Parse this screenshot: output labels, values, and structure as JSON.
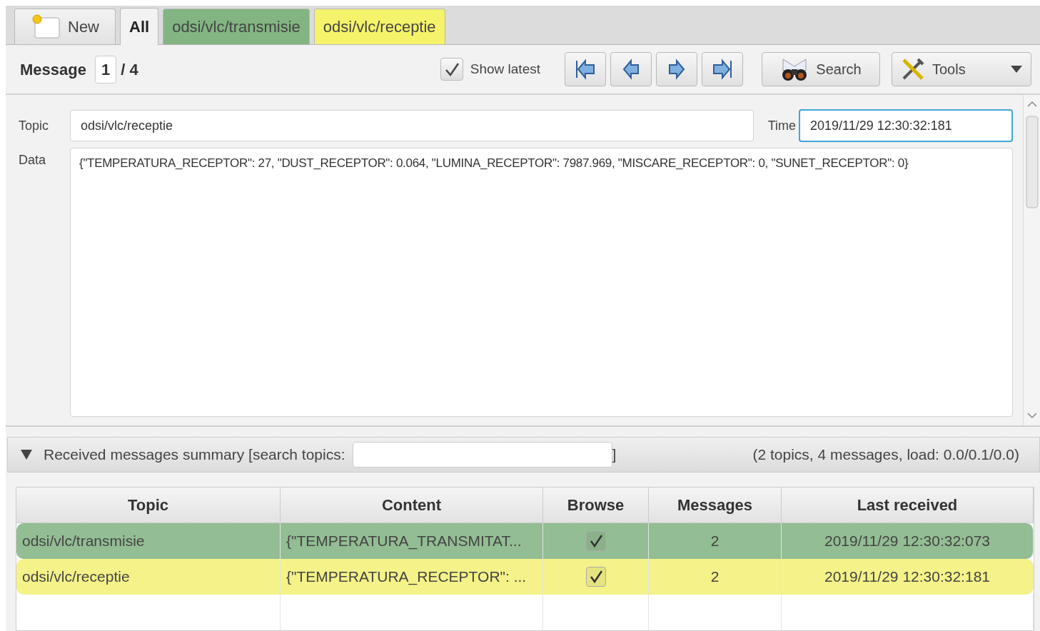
{
  "tabs": [
    {
      "kind": "new",
      "label": "New",
      "selected": false
    },
    {
      "kind": "plain",
      "label": "All",
      "selected": true
    },
    {
      "kind": "topic",
      "label": "odsi/vlc/transmisie",
      "selected": false,
      "color": "#82b582"
    },
    {
      "kind": "topic",
      "label": "odsi/vlc/receptie",
      "selected": false,
      "color": "#f5f36a"
    }
  ],
  "toolbar": {
    "message_label": "Message",
    "message_index": "1",
    "message_total": "/ 4",
    "show_latest": {
      "label": "Show latest",
      "checked": true
    },
    "search_button": "Search",
    "tools_button": "Tools"
  },
  "message": {
    "topic_label": "Topic",
    "topic": "odsi/vlc/receptie",
    "time_label": "Time",
    "time": "2019/11/29 12:30:32:181",
    "data_label": "Data",
    "data": "{\"TEMPERATURA_RECEPTOR\": 27, \"DUST_RECEPTOR\": 0.064, \"LUMINA_RECEPTOR\": 7987.969, \"MISCARE_RECEPTOR\": 0, \"SUNET_RECEPTOR\": 0}"
  },
  "summary": {
    "expanded": true,
    "title": "Received messages summary [search topics:",
    "title_end": "]",
    "stats": "(2 topics, 4 messages, load: 0.0/0.1/0.0)"
  },
  "table": {
    "columns": [
      "Topic",
      "Content",
      "Browse",
      "Messages",
      "Last received"
    ],
    "rows": [
      {
        "topic": "odsi/vlc/transmisie",
        "content": "{\"TEMPERATURA_TRANSMITAT...",
        "browse": true,
        "messages": "2",
        "last_received": "2019/11/29 12:30:32:073",
        "color": "#93bd93"
      },
      {
        "topic": "odsi/vlc/receptie",
        "content": "{\"TEMPERATURA_RECEPTOR\": ...",
        "browse": true,
        "messages": "2",
        "last_received": "2019/11/29 12:30:32:181",
        "color": "#f4f288"
      }
    ]
  }
}
